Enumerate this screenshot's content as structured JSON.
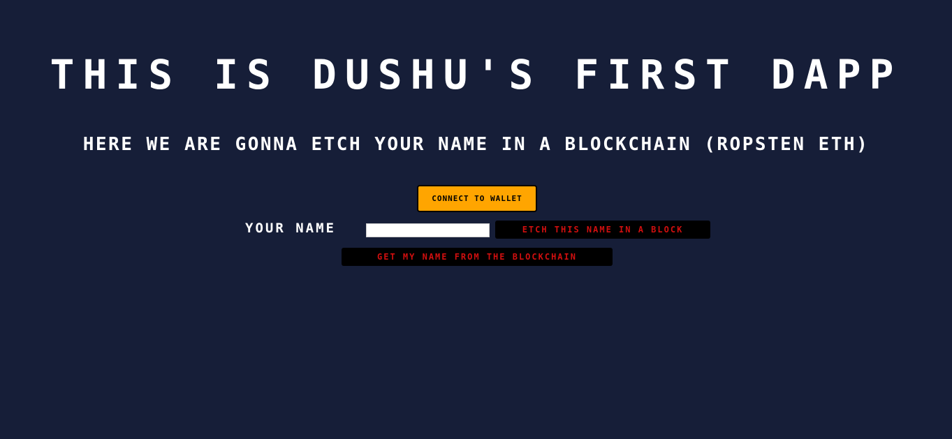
{
  "header": {
    "title": "THIS IS DUSHU'S FIRST DAPP",
    "subtitle": "HERE WE ARE GONNA ETCH YOUR NAME IN A BLOCKCHAIN (ROPSTEN ETH)"
  },
  "wallet": {
    "connect_label": "CONNECT TO WALLET"
  },
  "form": {
    "name_label": "YOUR NAME",
    "name_value": "",
    "etch_label": "ETCH THIS NAME IN A BLOCK",
    "get_label": "GET MY NAME FROM THE BLOCKCHAIN"
  },
  "colors": {
    "background": "#161e38",
    "accent": "#ffa500",
    "button_text": "#d10f0f"
  }
}
